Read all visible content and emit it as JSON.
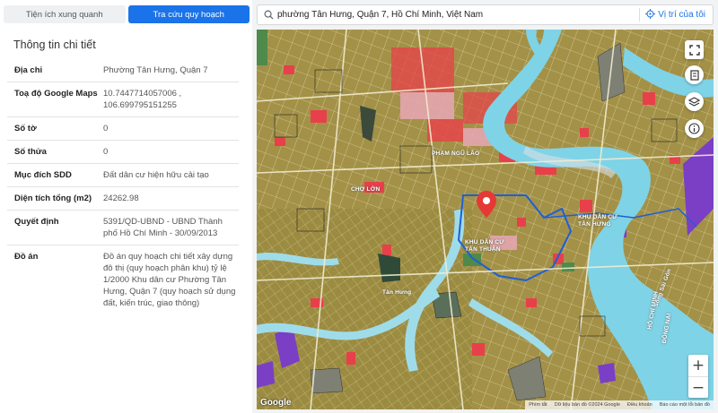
{
  "tabs": {
    "nearby": "Tiện ích xung quanh",
    "planning": "Tra cứu quy hoạch"
  },
  "panel": {
    "title": "Thông tin chi tiết",
    "rows": [
      {
        "label": "Địa chỉ",
        "value": "Phường Tân Hưng, Quận 7"
      },
      {
        "label": "Toạ độ Google Maps",
        "value": "10.7447714057006 , 106.699795151255"
      },
      {
        "label": "Số tờ",
        "value": "0"
      },
      {
        "label": "Số thửa",
        "value": "0"
      },
      {
        "label": "Mục đích SDD",
        "value": "Đất dân cư hiện hữu cải tạo"
      },
      {
        "label": "Diện tích tổng (m2)",
        "value": "24262.98"
      },
      {
        "label": "Quyết định",
        "value": "5391/QD-UBND - UBND Thành phố Hồ Chí Minh - 30/09/2013"
      },
      {
        "label": "Đồ án",
        "value": "Đồ án quy hoạch chi tiết xây dựng đô thị (quy hoạch phân khu) tỷ lệ 1/2000 Khu dân cư Phường Tân Hưng, Quận 7 (quy hoạch sử dụng đất, kiến trúc, giao thông)"
      }
    ]
  },
  "search": {
    "value": "phường Tân Hưng, Quận 7, Hồ Chí Minh, Việt Nam",
    "locate_label": "Vị trí của tôi"
  },
  "map": {
    "labels": [
      {
        "text": "PHẠM NGŨ LÃO"
      },
      {
        "text": "KHU DÂN CƯ"
      },
      {
        "text": "TÂN HƯNG"
      },
      {
        "text": "KHU DÂN CƯ"
      },
      {
        "text": "TÂN THUẬN"
      },
      {
        "text": "HỒ CHÍ MINH"
      },
      {
        "text": "ĐÔNG NAI"
      },
      {
        "text": "CHỢ LỚN"
      },
      {
        "text": "Sông Sài Gòn"
      },
      {
        "text": "Tân Hưng"
      }
    ],
    "google_logo": "Google",
    "attribution": {
      "shortcuts": "Phím tắt",
      "map_data": "Dữ liệu bản đồ ©2024 Google",
      "terms": "Điều khoản",
      "report": "Báo cáo một lỗi bản đồ"
    },
    "colors": {
      "residential": "#a09048",
      "river": "#7fd3e6",
      "red_zone": "#e8404a",
      "park": "#4f8a4a",
      "purple": "#7a3fc4",
      "boundary": "#1e5fd6",
      "pin": "#e53935"
    }
  }
}
